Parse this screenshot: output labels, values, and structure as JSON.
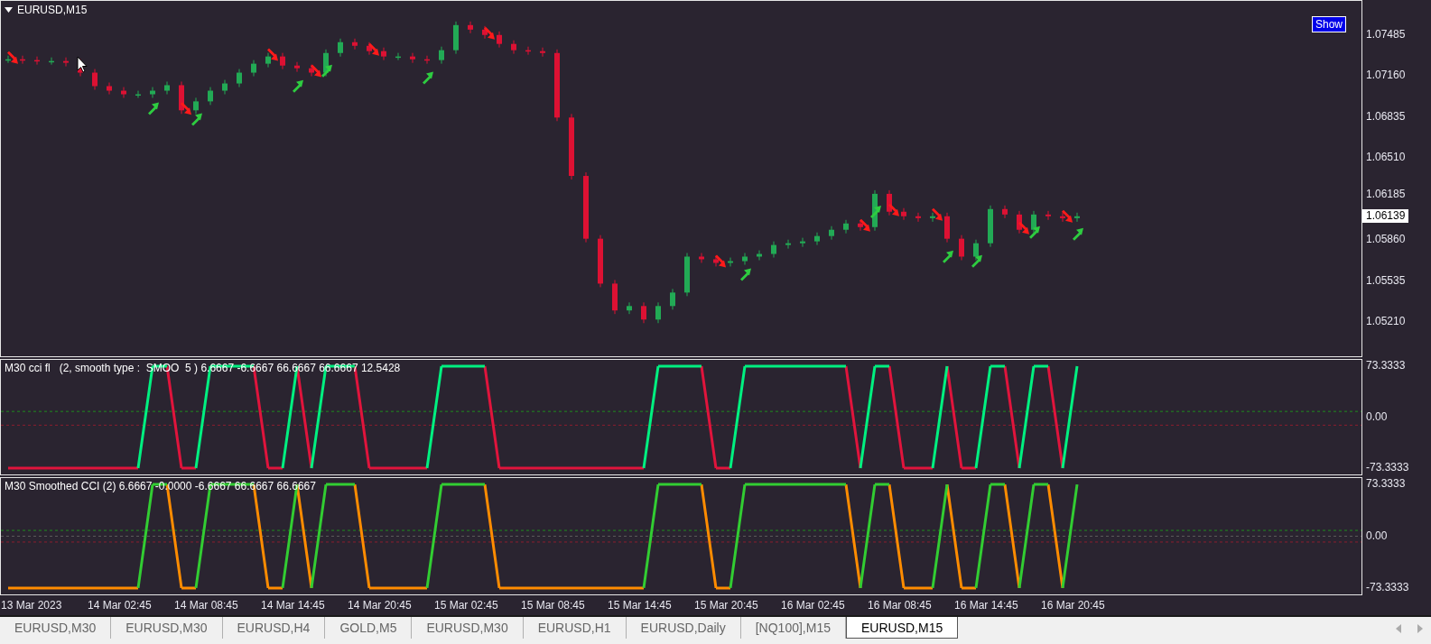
{
  "main_chart": {
    "title": "EURUSD,M15",
    "show_button": {
      "label": "Show"
    },
    "current_price": "1.06139",
    "price_axis": [
      "1.07485",
      "1.07160",
      "1.06835",
      "1.06510",
      "1.06185",
      "1.05860",
      "1.05535",
      "1.05210"
    ]
  },
  "indicators": [
    {
      "title": "M30 cci fl   (2, smooth type :  SMOO  5 ) 6.6667 -6.6667 66.6667 66.6667 12.5428",
      "axis": [
        "73.3333",
        "0.00",
        "-73.3333"
      ]
    },
    {
      "title": "M30 Smoothed CCI (2) 6.6667 -0.0000 -6.6667 66.6667 66.6667",
      "axis": [
        "73.3333",
        "0.00",
        "-73.3333"
      ]
    }
  ],
  "time_axis": [
    "13 Mar 2023",
    "14 Mar 02:45",
    "14 Mar 08:45",
    "14 Mar 14:45",
    "14 Mar 20:45",
    "15 Mar 02:45",
    "15 Mar 08:45",
    "15 Mar 14:45",
    "15 Mar 20:45",
    "16 Mar 02:45",
    "16 Mar 08:45",
    "16 Mar 14:45",
    "16 Mar 20:45"
  ],
  "tabs": [
    {
      "label": "EURUSD,M30",
      "selected": false
    },
    {
      "label": "EURUSD,M30",
      "selected": false
    },
    {
      "label": "EURUSD,H4",
      "selected": false
    },
    {
      "label": "GOLD,M5",
      "selected": false
    },
    {
      "label": "EURUSD,M30",
      "selected": false
    },
    {
      "label": "EURUSD,H1",
      "selected": false
    },
    {
      "label": "EURUSD,Daily",
      "selected": false
    },
    {
      "label": "[NQ100],M15",
      "selected": false
    },
    {
      "label": "EURUSD,M15",
      "selected": true
    }
  ]
}
